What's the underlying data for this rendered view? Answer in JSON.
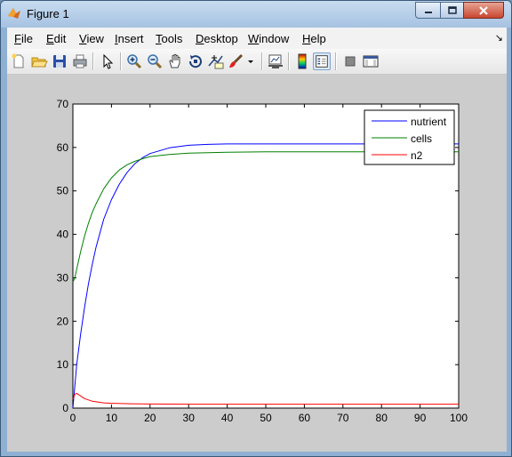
{
  "window": {
    "title": "Figure 1"
  },
  "menu": [
    {
      "label": "File",
      "u": "F",
      "rest": "ile"
    },
    {
      "label": "Edit",
      "u": "E",
      "rest": "dit"
    },
    {
      "label": "View",
      "u": "V",
      "rest": "iew"
    },
    {
      "label": "Insert",
      "u": "I",
      "rest": "nsert"
    },
    {
      "label": "Tools",
      "u": "T",
      "rest": "ools"
    },
    {
      "label": "Desktop",
      "u": "D",
      "rest": "esktop"
    },
    {
      "label": "Window",
      "u": "W",
      "rest": "indow"
    },
    {
      "label": "Help",
      "u": "H",
      "rest": "elp"
    }
  ],
  "toolbar_icons": [
    "new-figure-icon",
    "open-file-icon",
    "save-icon",
    "print-icon",
    "edit-plot-arrow-icon",
    "zoom-in-icon",
    "zoom-out-icon",
    "pan-hand-icon",
    "rotate-3d-icon",
    "data-cursor-icon",
    "brush-icon",
    "brush-dropdown-icon",
    "link-plot-icon",
    "insert-colorbar-icon",
    "insert-legend-icon",
    "hide-plot-tools-icon",
    "show-plot-tools-icon"
  ],
  "colors": {
    "nutrient": "#0000ff",
    "cells": "#008000",
    "n2": "#ff0000"
  },
  "chart_data": {
    "type": "line",
    "title": "",
    "xlabel": "",
    "ylabel": "",
    "xlim": [
      0,
      100
    ],
    "ylim": [
      0,
      70
    ],
    "xticks": [
      0,
      10,
      20,
      30,
      40,
      50,
      60,
      70,
      80,
      90,
      100
    ],
    "yticks": [
      0,
      10,
      20,
      30,
      40,
      50,
      60,
      70
    ],
    "legend_position": "top-right",
    "grid": false,
    "series": [
      {
        "name": "nutrient",
        "color": "#0000ff",
        "x": [
          0,
          1,
          2,
          3,
          4,
          5,
          6,
          8,
          10,
          12,
          14,
          16,
          18,
          20,
          25,
          30,
          35,
          40,
          50,
          60,
          70,
          80,
          90,
          100
        ],
        "y": [
          0,
          10,
          17,
          23,
          28.5,
          33,
          37,
          43.5,
          48,
          51.5,
          54.2,
          56.2,
          57.6,
          58.6,
          59.9,
          60.5,
          60.7,
          60.8,
          60.8,
          60.8,
          60.8,
          60.8,
          60.8,
          60.8
        ]
      },
      {
        "name": "cells",
        "color": "#008000",
        "x": [
          0,
          0.5,
          1,
          2,
          3,
          4,
          5,
          6,
          8,
          10,
          12,
          14,
          16,
          18,
          20,
          25,
          30,
          40,
          50,
          60,
          70,
          80,
          90,
          100
        ],
        "y": [
          29,
          30,
          32,
          36,
          39.5,
          42.5,
          45,
          47,
          50.5,
          53,
          54.8,
          56,
          56.8,
          57.4,
          57.9,
          58.4,
          58.7,
          58.9,
          59,
          59,
          59,
          59,
          59,
          59
        ]
      },
      {
        "name": "n2",
        "color": "#ff0000",
        "x": [
          0,
          0.5,
          1,
          2,
          3,
          5,
          8,
          10,
          15,
          20,
          30,
          40,
          50,
          60,
          70,
          80,
          90,
          100
        ],
        "y": [
          2,
          3.2,
          3.4,
          2.8,
          2.2,
          1.6,
          1.2,
          1.1,
          1.0,
          0.95,
          0.9,
          0.9,
          0.9,
          0.9,
          0.9,
          0.9,
          0.9,
          0.9
        ]
      }
    ]
  }
}
